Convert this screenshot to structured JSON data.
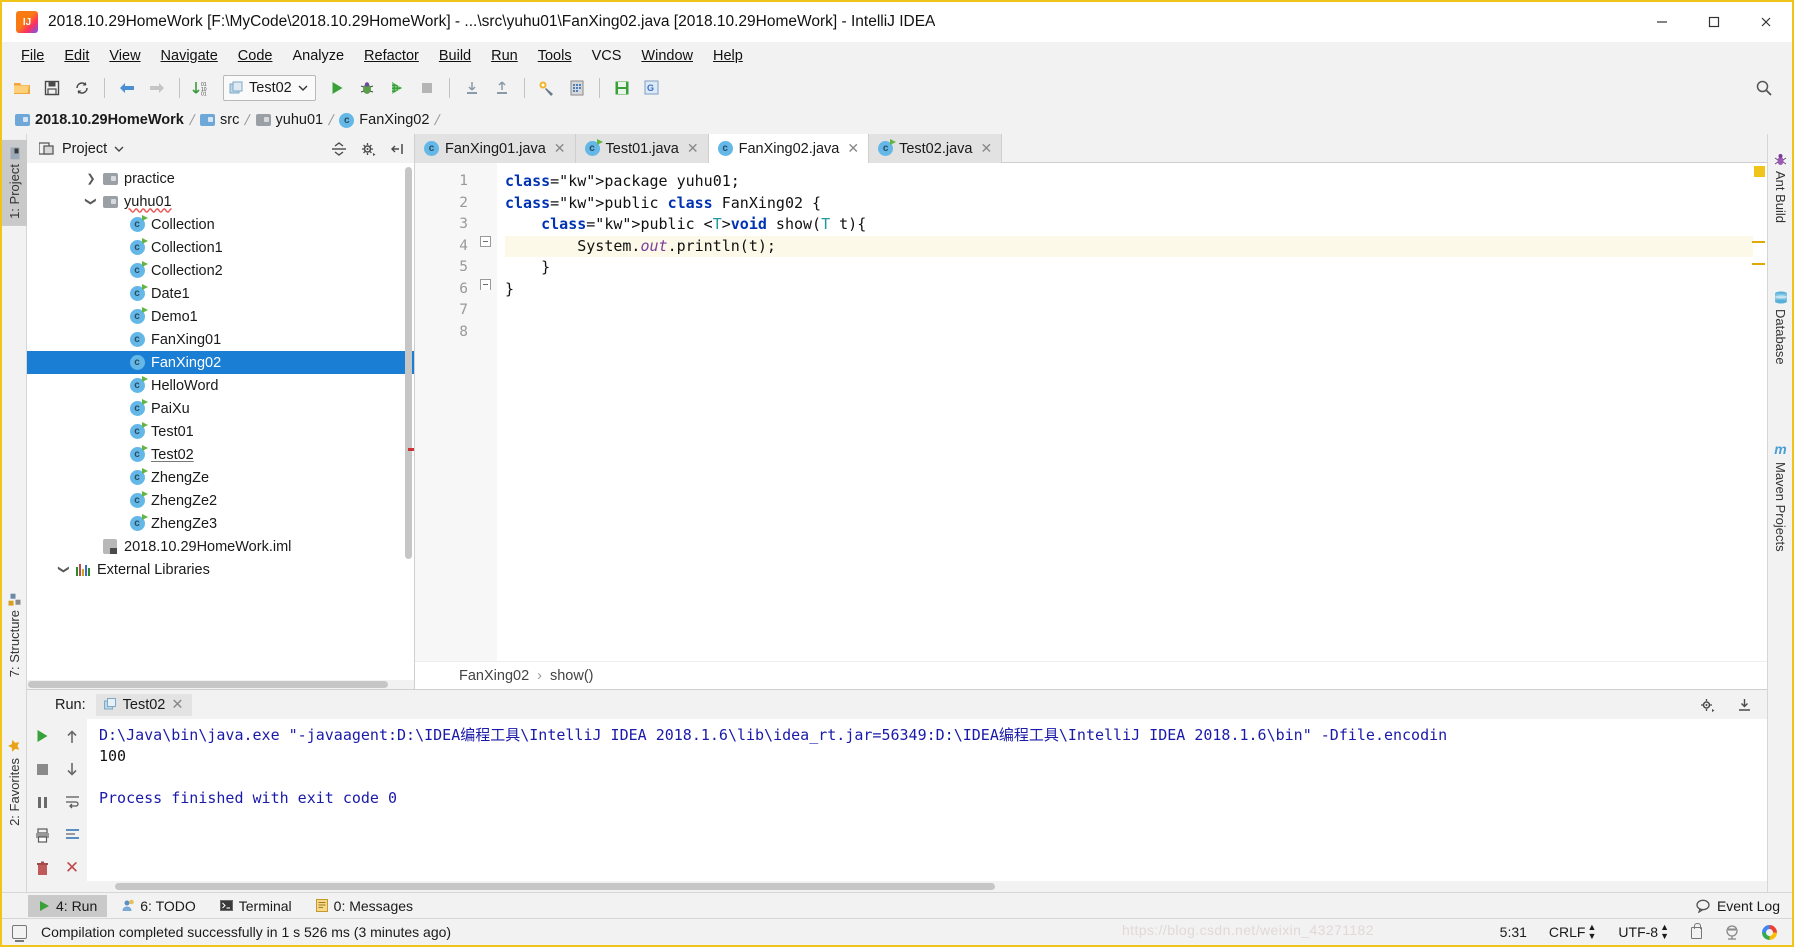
{
  "window": {
    "title": "2018.10.29HomeWork [F:\\MyCode\\2018.10.29HomeWork] - ...\\src\\yuhu01\\FanXing02.java [2018.10.29HomeWork] - IntelliJ IDEA",
    "minimize": "—",
    "maximize": "☐",
    "close": "✕"
  },
  "menu": {
    "items": [
      "File",
      "Edit",
      "View",
      "Navigate",
      "Code",
      "Analyze",
      "Refactor",
      "Build",
      "Run",
      "Tools",
      "VCS",
      "Window",
      "Help"
    ]
  },
  "toolbar": {
    "run_configuration": "Test02",
    "icons": [
      "open-folder-icon",
      "save-all-icon",
      "sync-icon",
      "back-icon",
      "forward-icon",
      "sort-icon",
      "run-icon",
      "debug-icon",
      "run-coverage-icon",
      "stop-icon",
      "update-project-icon",
      "commit-icon",
      "settings-icon",
      "project-structure-icon",
      "save-icon",
      "search-everywhere-icon"
    ]
  },
  "breadcrumb": {
    "items": [
      {
        "label": "2018.10.29HomeWork",
        "icon": "module-icon"
      },
      {
        "label": "src",
        "icon": "folder-icon"
      },
      {
        "label": "yuhu01",
        "icon": "package-icon"
      },
      {
        "label": "FanXing02",
        "icon": "class-icon"
      }
    ]
  },
  "left_rail": {
    "tabs": [
      {
        "label": "1: Project",
        "active": true
      },
      {
        "label": "7: Structure",
        "active": false
      },
      {
        "label": "2: Favorites",
        "active": false
      }
    ]
  },
  "right_rail": {
    "tabs": [
      "Ant Build",
      "Database",
      "Maven Projects"
    ]
  },
  "project_panel": {
    "title": "Project",
    "tree": [
      {
        "label": "practice",
        "depth": 1,
        "twist": "›",
        "icon": "folder-icon",
        "kind": "folder"
      },
      {
        "label": "yuhu01",
        "depth": 1,
        "twist": "⌄",
        "icon": "folder-icon",
        "kind": "folder",
        "squiggle": true
      },
      {
        "label": "Collection",
        "depth": 2,
        "icon": "java-class-runnable-icon",
        "kind": "class-run"
      },
      {
        "label": "Collection1",
        "depth": 2,
        "icon": "java-class-runnable-icon",
        "kind": "class-run"
      },
      {
        "label": "Collection2",
        "depth": 2,
        "icon": "java-class-runnable-icon",
        "kind": "class-run"
      },
      {
        "label": "Date1",
        "depth": 2,
        "icon": "java-class-runnable-icon",
        "kind": "class-run"
      },
      {
        "label": "Demo1",
        "depth": 2,
        "icon": "java-class-runnable-icon",
        "kind": "class-run"
      },
      {
        "label": "FanXing01",
        "depth": 2,
        "icon": "java-class-icon",
        "kind": "class"
      },
      {
        "label": "FanXing02",
        "depth": 2,
        "icon": "java-class-icon",
        "kind": "class",
        "selected": true
      },
      {
        "label": "HelloWord",
        "depth": 2,
        "icon": "java-class-runnable-icon",
        "kind": "class-run"
      },
      {
        "label": "PaiXu",
        "depth": 2,
        "icon": "java-class-runnable-icon",
        "kind": "class-run"
      },
      {
        "label": "Test01",
        "depth": 2,
        "icon": "java-class-runnable-icon",
        "kind": "class-run"
      },
      {
        "label": "Test02",
        "depth": 2,
        "icon": "java-class-runnable-icon",
        "kind": "class-run",
        "squiggle": true,
        "underline": true
      },
      {
        "label": "ZhengZe",
        "depth": 2,
        "icon": "java-class-runnable-icon",
        "kind": "class-run"
      },
      {
        "label": "ZhengZe2",
        "depth": 2,
        "icon": "java-class-runnable-icon",
        "kind": "class-run"
      },
      {
        "label": "ZhengZe3",
        "depth": 2,
        "icon": "java-class-runnable-icon",
        "kind": "class-run"
      },
      {
        "label": "2018.10.29HomeWork.iml",
        "depth": 1,
        "icon": "iml-file-icon",
        "kind": "iml"
      },
      {
        "label": "External Libraries",
        "depth": 0,
        "twist": "⌄",
        "icon": "libraries-icon",
        "kind": "libs"
      }
    ]
  },
  "editor": {
    "tabs": [
      {
        "label": "FanXing01.java",
        "active": false,
        "runnable": false
      },
      {
        "label": "Test01.java",
        "active": false,
        "runnable": true
      },
      {
        "label": "FanXing02.java",
        "active": true,
        "runnable": false
      },
      {
        "label": "Test02.java",
        "active": false,
        "runnable": true
      }
    ],
    "line_numbers": [
      "1",
      "2",
      "3",
      "4",
      "5",
      "6",
      "7",
      "8"
    ],
    "code_lines": [
      "package yuhu01;",
      "",
      "public class FanXing02 {",
      "    public <T>void show(T t){",
      "        System.out.println(t);",
      "    }",
      "}",
      ""
    ],
    "current_line": 5,
    "breadcrumb": [
      "FanXing02",
      "show()"
    ]
  },
  "run_panel": {
    "label": "Run:",
    "tab": "Test02",
    "console_lines": [
      {
        "text": "D:\\Java\\bin\\java.exe \"-javaagent:D:\\IDEA编程工具\\IntelliJ IDEA 2018.1.6\\lib\\idea_rt.jar=56349:D:\\IDEA编程工具\\IntelliJ IDEA 2018.1.6\\bin\" -Dfile.encodin",
        "type": "cmd"
      },
      {
        "text": "100",
        "type": "out"
      },
      {
        "text": "",
        "type": "out"
      },
      {
        "text": "Process finished with exit code 0",
        "type": "cmd"
      }
    ]
  },
  "tool_windows": {
    "items": [
      {
        "label": "4: Run",
        "active": true,
        "icon": "run-icon"
      },
      {
        "label": "6: TODO",
        "active": false,
        "icon": "todo-icon"
      },
      {
        "label": "Terminal",
        "active": false,
        "icon": "terminal-icon"
      },
      {
        "label": "0: Messages",
        "active": false,
        "icon": "messages-icon"
      }
    ],
    "event_log": "Event Log"
  },
  "status_bar": {
    "message": "Compilation completed successfully in 1 s 526 ms (3 minutes ago)",
    "caret_position": "5:31",
    "line_separator": "CRLF",
    "encoding": "UTF-8",
    "watermark": "https://blog.csdn.net/weixin_43271182"
  },
  "colors": {
    "accent": "#1a7fd4",
    "keyword": "#0033b3",
    "console_cmd": "#1a1aaa",
    "run_green": "#62b543",
    "border_yellow": "#f0c419"
  }
}
